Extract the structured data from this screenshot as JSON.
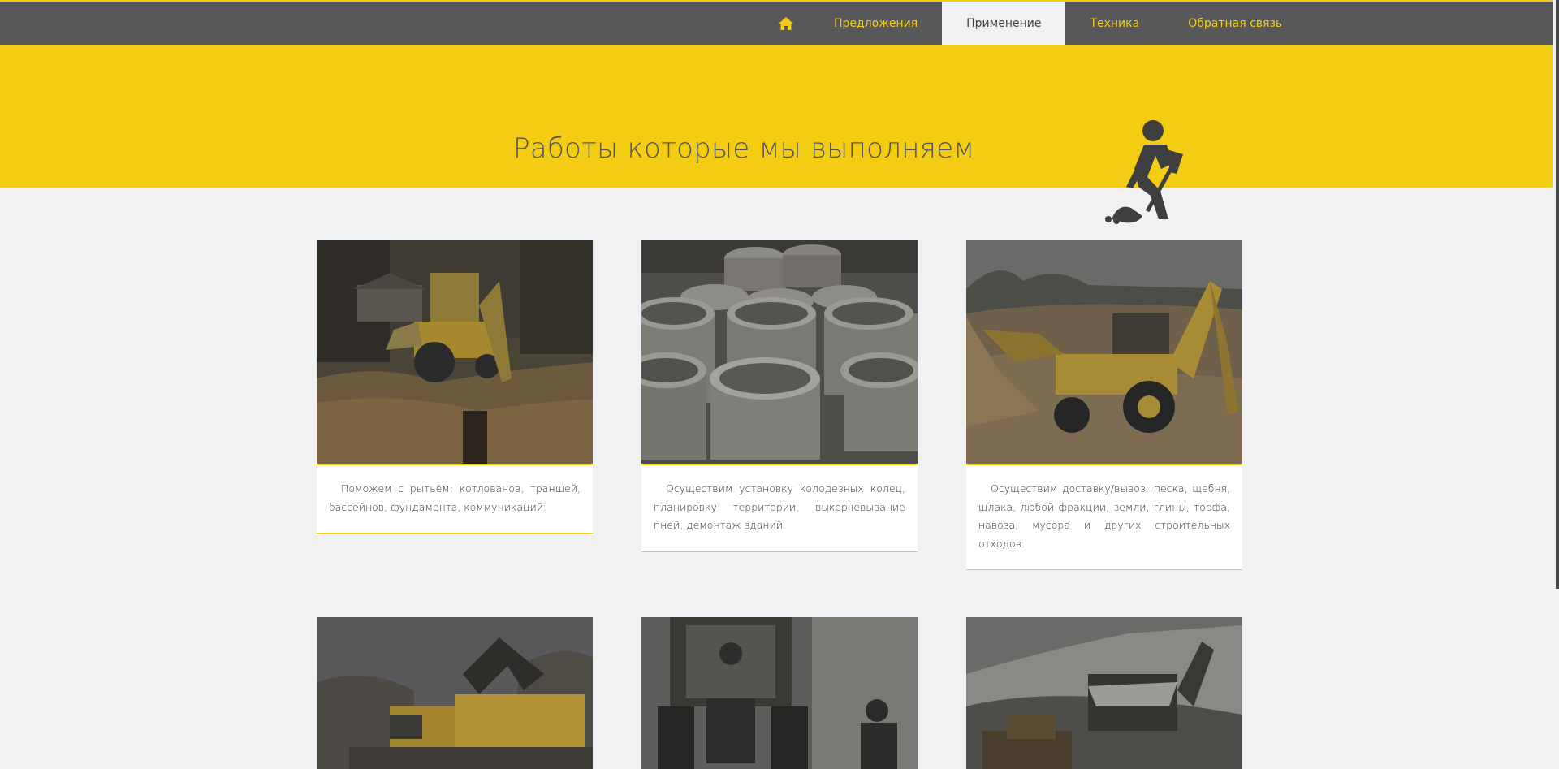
{
  "nav": {
    "home_icon": "home-icon",
    "items": [
      {
        "label": "Предложения",
        "active": false
      },
      {
        "label": "Применение",
        "active": true
      },
      {
        "label": "Техника",
        "active": false
      },
      {
        "label": "Обратная связь",
        "active": false
      }
    ]
  },
  "banner": {
    "title": "Работы которые мы выполняем",
    "icon": "digging-worker-icon"
  },
  "cards": [
    {
      "photo": "backhoe-trench-photo",
      "text": "Поможем с рытьём: котлованов, траншей, бассейнов, фундамента, коммуникаций."
    },
    {
      "photo": "concrete-rings-photo",
      "text": "Осуществим установку колодезных колец, планировку территории, выкорчевывание пней, демонтаж зданий."
    },
    {
      "photo": "backhoe-sand-photo",
      "text": "Осуществим доставку/вывоз: песка, щебня, шлака, любой фракции, земли, глины, торфа, навоза, мусора и других строительных отходов."
    },
    {
      "photo": "excavator-dump-truck-photo"
    },
    {
      "photo": "tractor-snow-photo"
    },
    {
      "photo": "snow-loader-photo"
    }
  ],
  "colors": {
    "accent": "#f4cc14",
    "nav_bg": "#58585a",
    "page_bg": "#f0f1f3"
  }
}
